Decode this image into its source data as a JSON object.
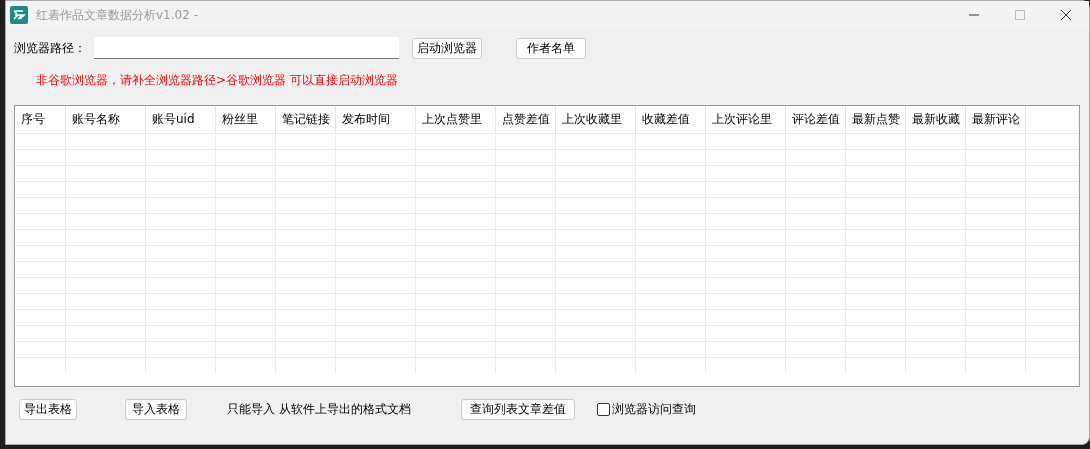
{
  "window": {
    "title": "红砉作品文章数据分析v1.02 -"
  },
  "browser_path": {
    "label": "浏览器路径："
  },
  "buttons_top": [
    "启动浏览器",
    "作者名单"
  ],
  "notice": "非谷歌浏览器，请补全浏览器路径>谷歌浏览器  可以直接启动浏览器",
  "table": {
    "columns": [
      "序号",
      "账号名称",
      "账号uid",
      "粉丝里",
      "笔记链接",
      "发布时间",
      "上次点赞里",
      "点赞差值",
      "上次收藏里",
      "收藏差值",
      "上次评论里",
      "评论差值",
      "最新点赞",
      "最新收藏",
      "最新评论"
    ]
  },
  "bottom": {
    "export_button": "导出表格",
    "import_button": "导入表格",
    "import_hint": "只能导入  从软件上导出的格式文档",
    "query_button": "查询列表文章差值",
    "browser_query": {
      "label": "浏览器访问查询",
      "checked": false
    }
  }
}
